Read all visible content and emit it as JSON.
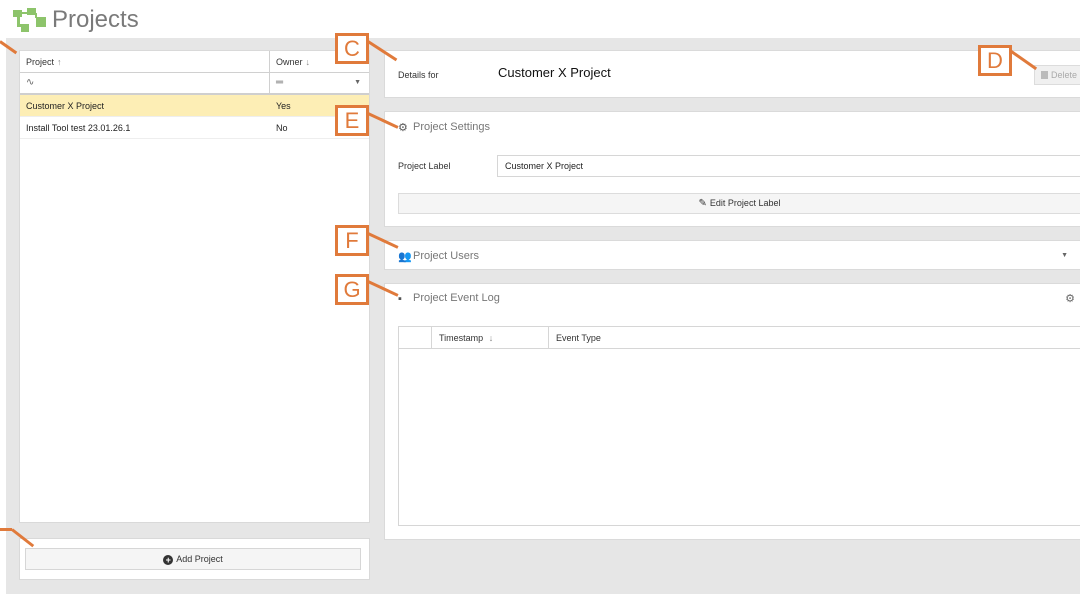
{
  "app": {
    "title": "Projects",
    "icon": "project-tree-icon"
  },
  "project_grid": {
    "columns": [
      {
        "label": "Project",
        "sort": "↑"
      },
      {
        "label": "Owner",
        "sort": "↓"
      }
    ],
    "filters": {
      "project": "∿",
      "owner": "═",
      "owner_dropdown": "▼"
    },
    "rows": [
      {
        "project": "Customer X Project",
        "owner": "Yes",
        "selected": true
      },
      {
        "project": "Install Tool test 23.01.26.1",
        "owner": "No",
        "selected": false
      }
    ]
  },
  "add_project": {
    "label": "Add Project",
    "icon": "plus-circle-icon"
  },
  "details": {
    "label": "Details for",
    "value": "Customer X Project",
    "delete_label": "Delete"
  },
  "settings": {
    "title": "Project Settings",
    "project_label_caption": "Project Label",
    "project_label_value": "Customer X Project",
    "edit_button_label": "Edit Project Label"
  },
  "users": {
    "title": "Project Users",
    "chevron": "▼"
  },
  "event_log": {
    "title": "Project Event Log",
    "columns": [
      {
        "label": ""
      },
      {
        "label": "Timestamp",
        "sort": "↓"
      },
      {
        "label": "Event Type"
      }
    ]
  },
  "callouts": [
    "C",
    "D",
    "E",
    "F",
    "G"
  ],
  "colors": {
    "accent": "#e07a3b",
    "selected_row": "#fdeeb5",
    "logo_green": "#8dc46b"
  }
}
